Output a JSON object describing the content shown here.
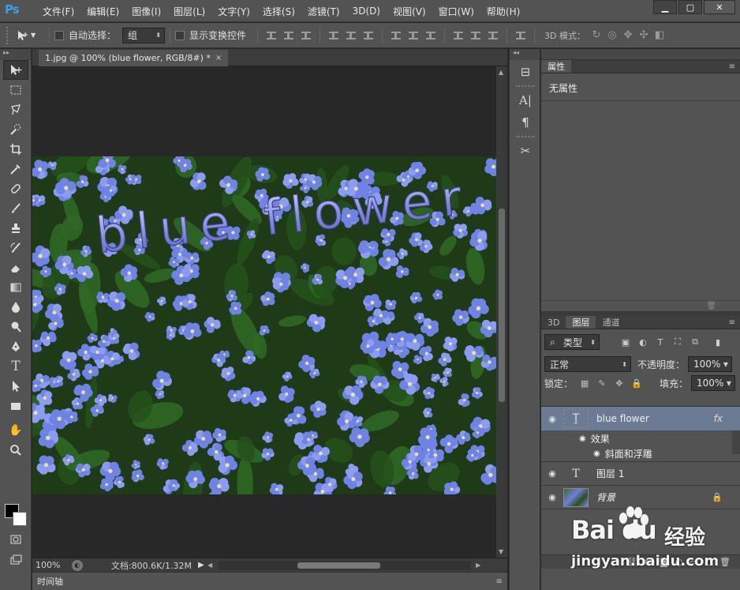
{
  "app": {
    "logo": "Ps"
  },
  "menu": [
    "文件(F)",
    "编辑(E)",
    "图像(I)",
    "图层(L)",
    "文字(Y)",
    "选择(S)",
    "滤镜(T)",
    "3D(D)",
    "视图(V)",
    "窗口(W)",
    "帮助(H)"
  ],
  "window_controls": {
    "minimize": "▁",
    "maximize": "▢",
    "close": "✕"
  },
  "options": {
    "auto_select_label": "自动选择：",
    "auto_select_value": "组",
    "show_transform_label": "显示变换控件",
    "mode3d_label": "3D 模式："
  },
  "document": {
    "tab_title": "1.jpg @ 100% (blue flower, RGB/8#) *",
    "tab_close": "×",
    "canvas_text": "blue flower"
  },
  "status": {
    "zoom": "100%",
    "doc_info": "文档:800.6K/1.32M"
  },
  "timeline": {
    "label": "时间轴"
  },
  "properties": {
    "tab": "属性",
    "empty_text": "无属性"
  },
  "layers_panel": {
    "tabs": [
      "3D",
      "图层",
      "通道"
    ],
    "filter_label": "类型",
    "blend_mode": "正常",
    "opacity_label": "不透明度：",
    "opacity_value": "100%",
    "lock_label": "锁定：",
    "fill_label": "填充：",
    "fill_value": "100%",
    "layers": [
      {
        "name": "blue flower",
        "type": "text-warp",
        "fx": "fx",
        "selected": true
      },
      {
        "name": "图层 1",
        "type": "text"
      },
      {
        "name": "背景",
        "type": "image",
        "locked": true
      }
    ],
    "effects_label": "效果",
    "effect_item": "斜面和浮雕"
  },
  "watermark": {
    "logo": "Bai  du",
    "cn": "经验",
    "url": "jingyan.baidu.com"
  },
  "colors": {
    "accent": "#3d9ee8",
    "panel": "#535353",
    "dark": "#282828",
    "selection": "#6b7b94"
  }
}
